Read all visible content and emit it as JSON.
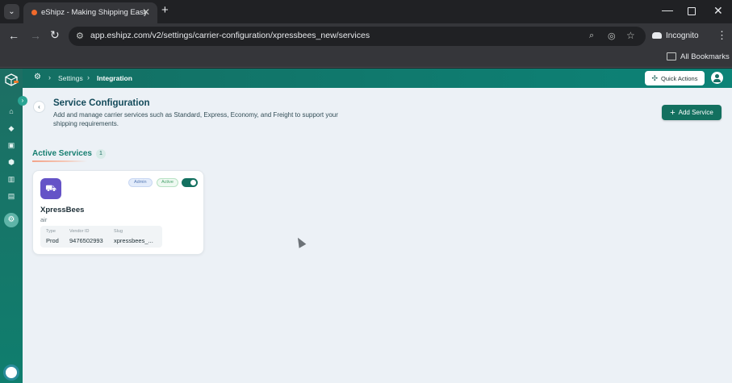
{
  "browser": {
    "tab_title": "eShipz - Making Shipping Easy",
    "url": "app.eshipz.com/v2/settings/carrier-configuration/xpressbees_new/services",
    "incognito_label": "Incognito",
    "bookmarks_label": "All Bookmarks"
  },
  "header": {
    "breadcrumb": [
      "Settings",
      "Integration"
    ],
    "quick_actions_label": "Quick Actions"
  },
  "page": {
    "title": "Service Configuration",
    "description": "Add and manage carrier services such as Standard, Express, Economy, and Freight to support your shipping requirements.",
    "add_service_label": "Add Service"
  },
  "section": {
    "title": "Active Services",
    "count": "1"
  },
  "services": [
    {
      "name": "XpressBees",
      "mode": "air",
      "badge_admin": "Admin",
      "badge_active": "Active",
      "enabled": true,
      "type_label": "Type",
      "type_value": "Prod",
      "vendor_label": "Vendor ID",
      "vendor_value": "9476502993",
      "slug_label": "Slug",
      "slug_value": "xpressbees_..."
    }
  ],
  "colors": {
    "brand": "#13705f",
    "accent": "#167e70",
    "card_icon": "#6553c7"
  },
  "icons": [
    "chevron-down-icon",
    "close-icon",
    "plus-icon",
    "back-arrow-icon",
    "forward-arrow-icon",
    "reload-icon",
    "site-info-icon",
    "zoom-icon",
    "eye-off-icon",
    "star-icon",
    "incognito-icon",
    "kebab-menu-icon",
    "folder-icon",
    "gear-icon",
    "home-icon",
    "truck-icon",
    "user-avatar-icon"
  ]
}
